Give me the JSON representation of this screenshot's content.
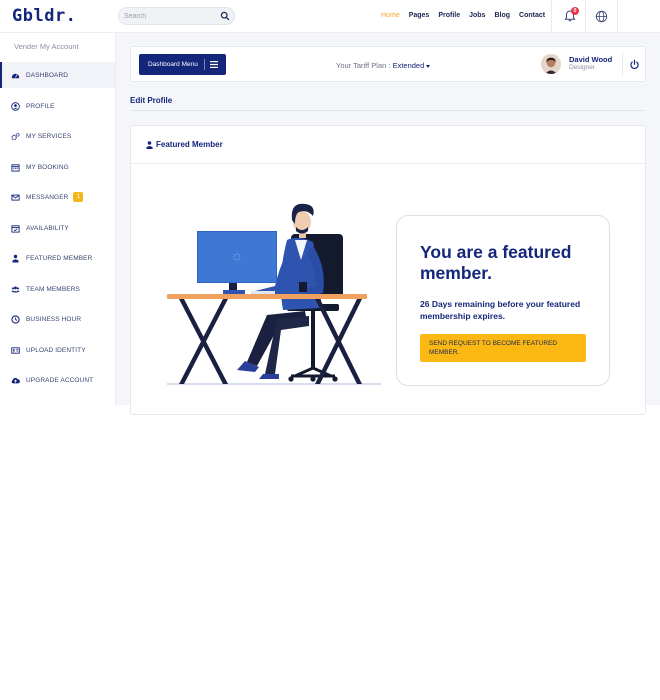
{
  "header": {
    "logo": "Gbldr.",
    "search_placeholder": "Search",
    "nav": [
      "Home",
      "Pages",
      "Profile",
      "Jobs",
      "Blog",
      "Contact"
    ],
    "active_nav": "Home",
    "notification_count": "0"
  },
  "sidebar": {
    "title": "Vender My Account",
    "items": [
      {
        "label": "DASHBOARD",
        "icon": "dashboard-icon"
      },
      {
        "label": "PROFILE",
        "icon": "user-circle-icon"
      },
      {
        "label": "MY SERVICES",
        "icon": "cogs-icon"
      },
      {
        "label": "MY BOOKING",
        "icon": "calendar-icon"
      },
      {
        "label": "MESSANGER",
        "icon": "envelope-icon",
        "badge": "1"
      },
      {
        "label": "AVAILABILITY",
        "icon": "calendar-check-icon"
      },
      {
        "label": "FEATURED MEMBER",
        "icon": "user-tie-icon"
      },
      {
        "label": "TEAM MEMBERS",
        "icon": "users-icon"
      },
      {
        "label": "BUSINESS HOUR",
        "icon": "clock-icon"
      },
      {
        "label": "UPLOAD IDENTITY",
        "icon": "id-card-icon"
      },
      {
        "label": "UPGRADE ACCOUNT",
        "icon": "cloud-upload-icon"
      }
    ]
  },
  "toolbar": {
    "dashboard_menu_label": "Dashboard Menu",
    "tariff_label": "Your Tariff Plan :",
    "tariff_value": "Extended",
    "user_name": "David Wood",
    "user_role": "Designer"
  },
  "content": {
    "section_title": "Edit Profile",
    "card_title": "Featured Member",
    "promo_title": "You are a featured member.",
    "promo_subtitle": "26 Days remaining before your featured membership expires.",
    "promo_button": "SEND REQUEST TO BECOME FEATURED MEMBER."
  },
  "colors": {
    "brand": "#14267a",
    "accent": "#fbb813",
    "active_nav": "#f5a623",
    "badge_red": "#e63946"
  }
}
